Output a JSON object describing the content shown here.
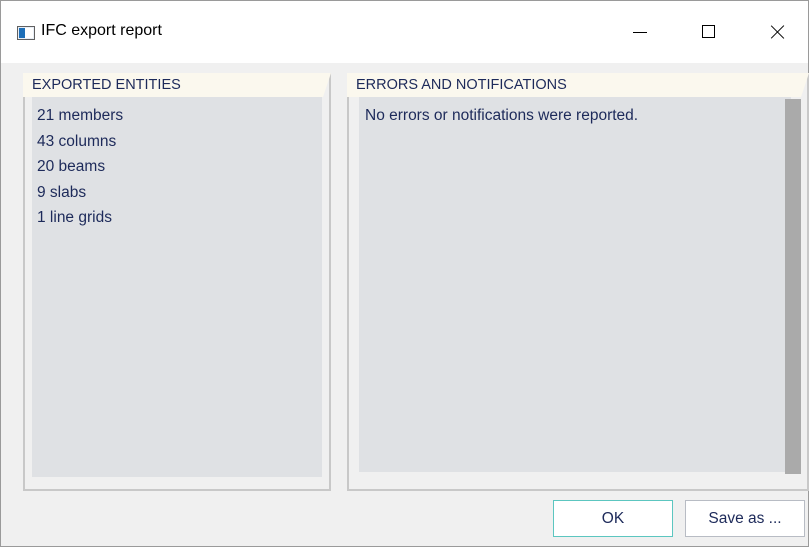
{
  "window": {
    "title": "IFC export report",
    "icon": "app-window-icon",
    "controls": {
      "minimize_icon": "minimize-icon",
      "maximize_icon": "maximize-icon",
      "close_icon": "close-icon"
    }
  },
  "exported_entities": {
    "header": "EXPORTED ENTITIES",
    "items": [
      "21 members",
      "43 columns",
      "20 beams",
      "9 slabs",
      "1 line grids"
    ]
  },
  "errors_notifications": {
    "header": "ERRORS AND NOTIFICATIONS",
    "message": "No errors or notifications were reported."
  },
  "buttons": {
    "ok_label": "OK",
    "save_label": "Save as ..."
  },
  "colors": {
    "text": "#1d2a5a",
    "header_bg": "#fbf8ee",
    "content_bg": "#dfe1e4",
    "ok_border": "#5cc6c0"
  }
}
